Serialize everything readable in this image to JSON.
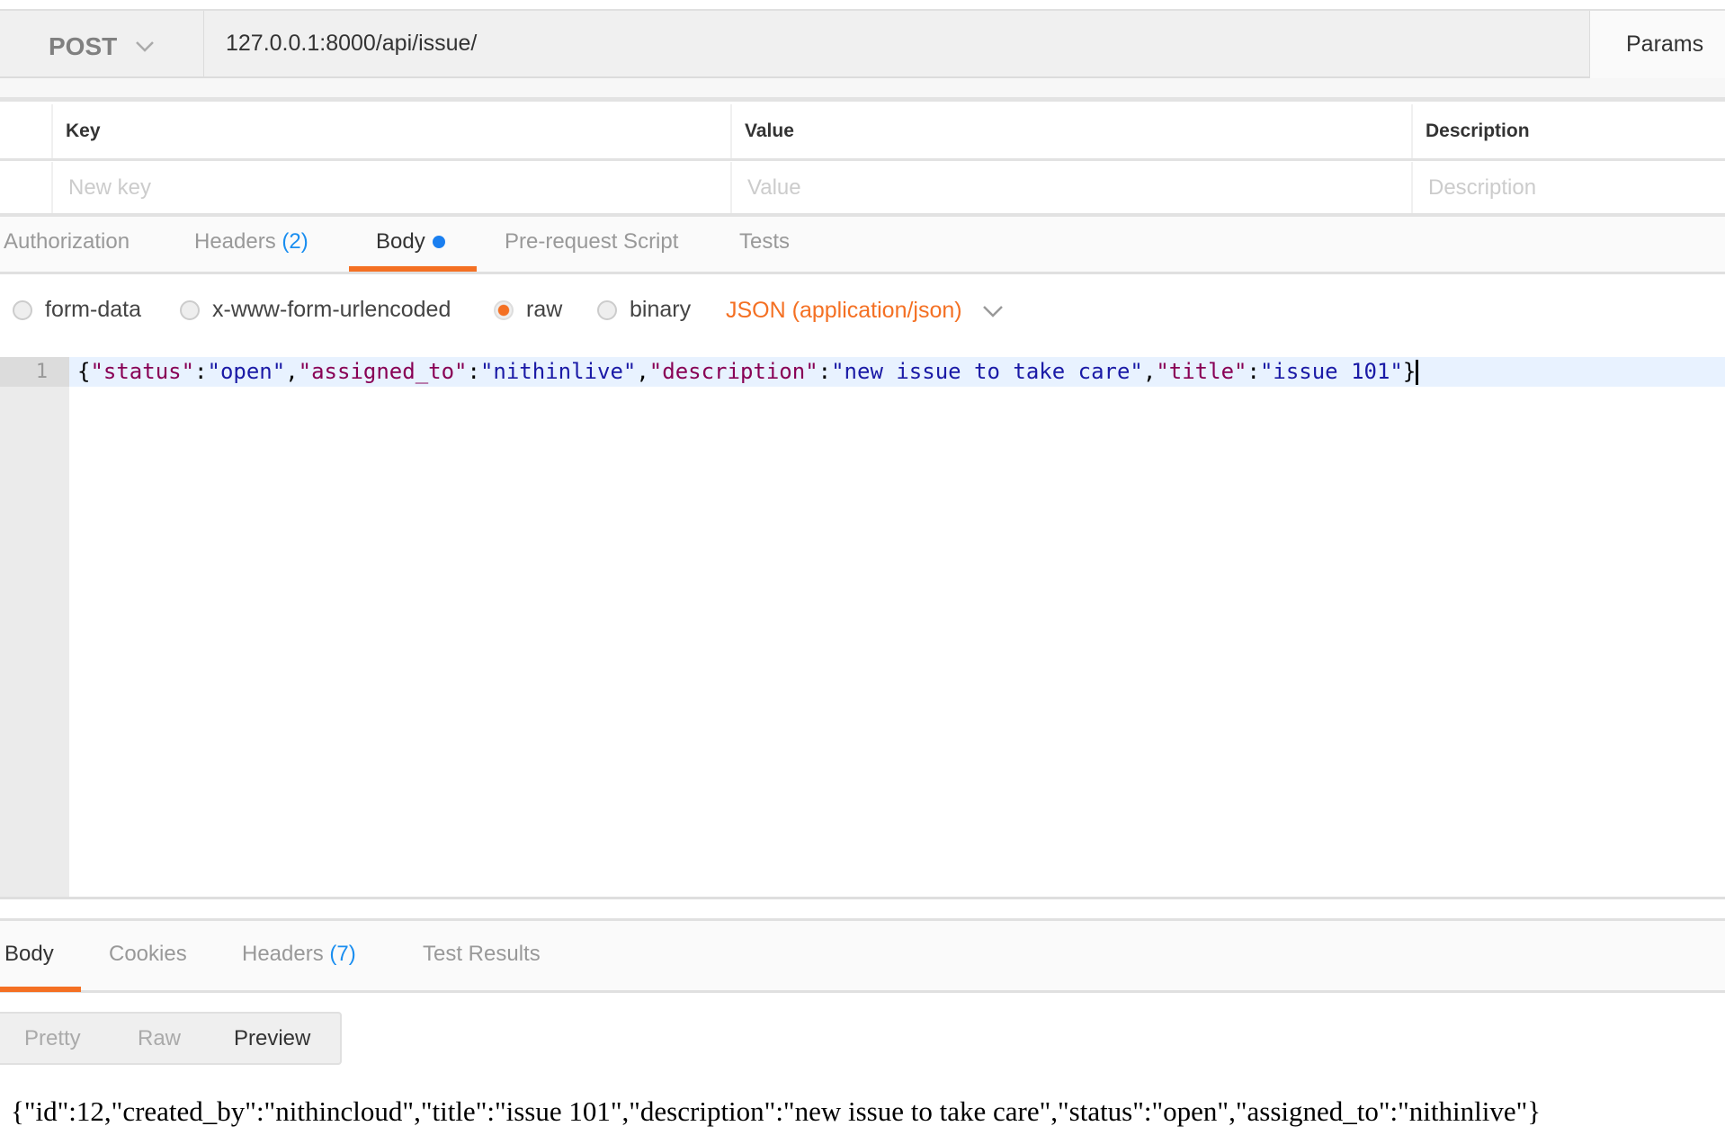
{
  "request": {
    "method": "POST",
    "url": "127.0.0.1:8000/api/issue/",
    "params_label": "Params"
  },
  "params_table": {
    "headers": [
      "Key",
      "Value",
      "Description"
    ],
    "placeholders": [
      "New key",
      "Value",
      "Description"
    ]
  },
  "request_tabs": [
    {
      "label": "Authorization"
    },
    {
      "label": "Headers",
      "count": "(2)"
    },
    {
      "label": "Body",
      "active": true,
      "modified_dot": true
    },
    {
      "label": "Pre-request Script"
    },
    {
      "label": "Tests"
    }
  ],
  "body_modes": [
    {
      "label": "form-data",
      "selected": false
    },
    {
      "label": "x-www-form-urlencoded",
      "selected": false
    },
    {
      "label": "raw",
      "selected": true
    },
    {
      "label": "binary",
      "selected": false
    }
  ],
  "content_type": "JSON (application/json)",
  "editor": {
    "line_number": "1",
    "code": "{\"status\":\"open\",\"assigned_to\":\"nithinlive\",\"description\":\"new issue to take care\",\"title\":\"issue 101\"}"
  },
  "response_tabs": [
    {
      "label": "Body",
      "active": true
    },
    {
      "label": "Cookies"
    },
    {
      "label": "Headers",
      "count": "(7)"
    },
    {
      "label": "Test Results"
    }
  ],
  "view_modes": [
    {
      "label": "Pretty"
    },
    {
      "label": "Raw"
    },
    {
      "label": "Preview",
      "active": true
    }
  ],
  "response_body": "{\"id\":12,\"created_by\":\"nithincloud\",\"title\":\"issue 101\",\"description\":\"new issue to take care\",\"status\":\"open\",\"assigned_to\":\"nithinlive\"}",
  "colors": {
    "accent": "#f47023",
    "count": "#1a8ef0",
    "json_key": "#880055",
    "json_string": "#1a1aa6"
  }
}
